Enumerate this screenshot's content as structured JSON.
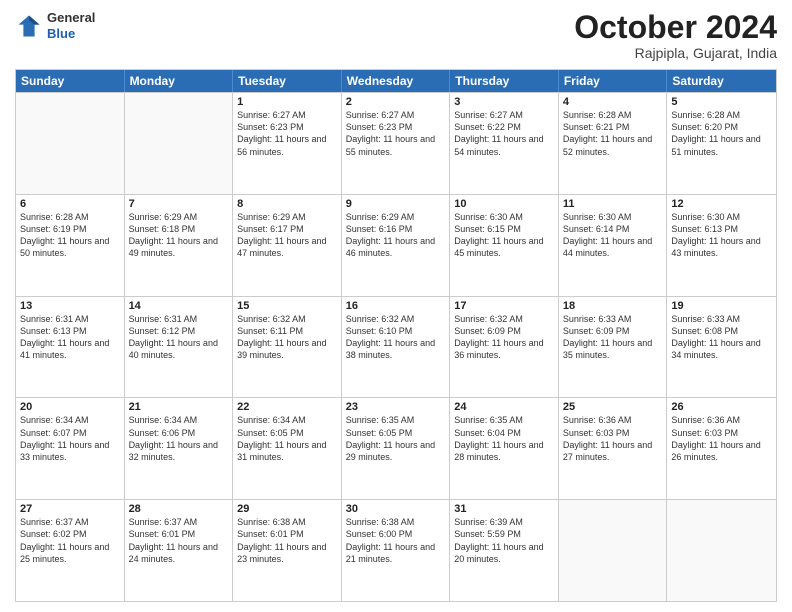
{
  "header": {
    "logo": {
      "line1": "General",
      "line2": "Blue"
    },
    "title": "October 2024",
    "subtitle": "Rajpipla, Gujarat, India"
  },
  "weekdays": [
    "Sunday",
    "Monday",
    "Tuesday",
    "Wednesday",
    "Thursday",
    "Friday",
    "Saturday"
  ],
  "weeks": [
    [
      {
        "day": "",
        "info": ""
      },
      {
        "day": "",
        "info": ""
      },
      {
        "day": "1",
        "info": "Sunrise: 6:27 AM\nSunset: 6:23 PM\nDaylight: 11 hours and 56 minutes."
      },
      {
        "day": "2",
        "info": "Sunrise: 6:27 AM\nSunset: 6:23 PM\nDaylight: 11 hours and 55 minutes."
      },
      {
        "day": "3",
        "info": "Sunrise: 6:27 AM\nSunset: 6:22 PM\nDaylight: 11 hours and 54 minutes."
      },
      {
        "day": "4",
        "info": "Sunrise: 6:28 AM\nSunset: 6:21 PM\nDaylight: 11 hours and 52 minutes."
      },
      {
        "day": "5",
        "info": "Sunrise: 6:28 AM\nSunset: 6:20 PM\nDaylight: 11 hours and 51 minutes."
      }
    ],
    [
      {
        "day": "6",
        "info": "Sunrise: 6:28 AM\nSunset: 6:19 PM\nDaylight: 11 hours and 50 minutes."
      },
      {
        "day": "7",
        "info": "Sunrise: 6:29 AM\nSunset: 6:18 PM\nDaylight: 11 hours and 49 minutes."
      },
      {
        "day": "8",
        "info": "Sunrise: 6:29 AM\nSunset: 6:17 PM\nDaylight: 11 hours and 47 minutes."
      },
      {
        "day": "9",
        "info": "Sunrise: 6:29 AM\nSunset: 6:16 PM\nDaylight: 11 hours and 46 minutes."
      },
      {
        "day": "10",
        "info": "Sunrise: 6:30 AM\nSunset: 6:15 PM\nDaylight: 11 hours and 45 minutes."
      },
      {
        "day": "11",
        "info": "Sunrise: 6:30 AM\nSunset: 6:14 PM\nDaylight: 11 hours and 44 minutes."
      },
      {
        "day": "12",
        "info": "Sunrise: 6:30 AM\nSunset: 6:13 PM\nDaylight: 11 hours and 43 minutes."
      }
    ],
    [
      {
        "day": "13",
        "info": "Sunrise: 6:31 AM\nSunset: 6:13 PM\nDaylight: 11 hours and 41 minutes."
      },
      {
        "day": "14",
        "info": "Sunrise: 6:31 AM\nSunset: 6:12 PM\nDaylight: 11 hours and 40 minutes."
      },
      {
        "day": "15",
        "info": "Sunrise: 6:32 AM\nSunset: 6:11 PM\nDaylight: 11 hours and 39 minutes."
      },
      {
        "day": "16",
        "info": "Sunrise: 6:32 AM\nSunset: 6:10 PM\nDaylight: 11 hours and 38 minutes."
      },
      {
        "day": "17",
        "info": "Sunrise: 6:32 AM\nSunset: 6:09 PM\nDaylight: 11 hours and 36 minutes."
      },
      {
        "day": "18",
        "info": "Sunrise: 6:33 AM\nSunset: 6:09 PM\nDaylight: 11 hours and 35 minutes."
      },
      {
        "day": "19",
        "info": "Sunrise: 6:33 AM\nSunset: 6:08 PM\nDaylight: 11 hours and 34 minutes."
      }
    ],
    [
      {
        "day": "20",
        "info": "Sunrise: 6:34 AM\nSunset: 6:07 PM\nDaylight: 11 hours and 33 minutes."
      },
      {
        "day": "21",
        "info": "Sunrise: 6:34 AM\nSunset: 6:06 PM\nDaylight: 11 hours and 32 minutes."
      },
      {
        "day": "22",
        "info": "Sunrise: 6:34 AM\nSunset: 6:05 PM\nDaylight: 11 hours and 31 minutes."
      },
      {
        "day": "23",
        "info": "Sunrise: 6:35 AM\nSunset: 6:05 PM\nDaylight: 11 hours and 29 minutes."
      },
      {
        "day": "24",
        "info": "Sunrise: 6:35 AM\nSunset: 6:04 PM\nDaylight: 11 hours and 28 minutes."
      },
      {
        "day": "25",
        "info": "Sunrise: 6:36 AM\nSunset: 6:03 PM\nDaylight: 11 hours and 27 minutes."
      },
      {
        "day": "26",
        "info": "Sunrise: 6:36 AM\nSunset: 6:03 PM\nDaylight: 11 hours and 26 minutes."
      }
    ],
    [
      {
        "day": "27",
        "info": "Sunrise: 6:37 AM\nSunset: 6:02 PM\nDaylight: 11 hours and 25 minutes."
      },
      {
        "day": "28",
        "info": "Sunrise: 6:37 AM\nSunset: 6:01 PM\nDaylight: 11 hours and 24 minutes."
      },
      {
        "day": "29",
        "info": "Sunrise: 6:38 AM\nSunset: 6:01 PM\nDaylight: 11 hours and 23 minutes."
      },
      {
        "day": "30",
        "info": "Sunrise: 6:38 AM\nSunset: 6:00 PM\nDaylight: 11 hours and 21 minutes."
      },
      {
        "day": "31",
        "info": "Sunrise: 6:39 AM\nSunset: 5:59 PM\nDaylight: 11 hours and 20 minutes."
      },
      {
        "day": "",
        "info": ""
      },
      {
        "day": "",
        "info": ""
      }
    ]
  ]
}
